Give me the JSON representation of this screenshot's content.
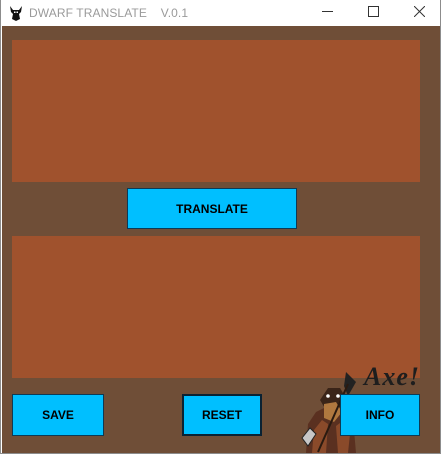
{
  "window": {
    "title": "DWARF TRANSLATE    V.0.1",
    "app_icon": "dwarf-head-icon",
    "controls": {
      "minimize": "minimize-icon",
      "maximize": "maximize-icon",
      "close": "close-icon"
    }
  },
  "input_box": {
    "value": "",
    "placeholder": ""
  },
  "output_box": {
    "value": "",
    "placeholder": ""
  },
  "buttons": {
    "translate": "TRANSLATE",
    "save": "SAVE",
    "reset": "RESET",
    "info": "INFO"
  },
  "decoration": {
    "mascot_text": "Axe!",
    "mascot_icon": "dwarf-with-axe-illustration"
  },
  "colors": {
    "background": "#6f4e37",
    "textbox": "#a0522d",
    "button": "#00bfff",
    "title_text": "#9a9a9a"
  }
}
